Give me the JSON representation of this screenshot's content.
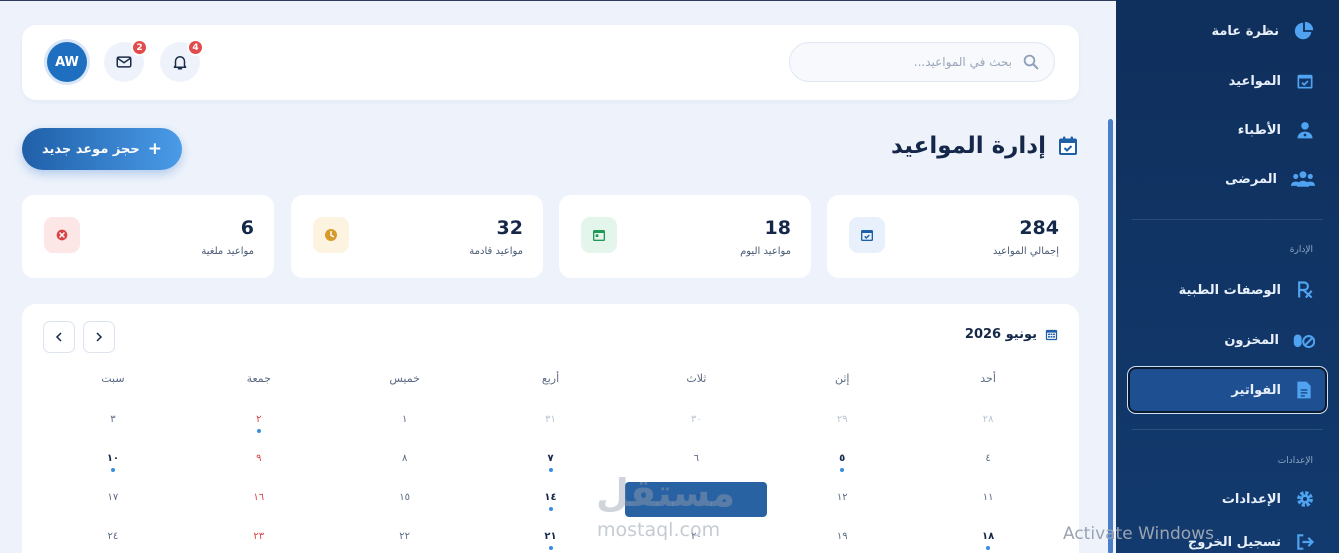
{
  "header": {
    "search_placeholder": "بحث في المواعيد...",
    "notifications_count": "4",
    "messages_count": "2",
    "avatar_initials": "AW"
  },
  "page": {
    "title": "إدارة المواعيد",
    "new_button_label": "حجز موعد جديد"
  },
  "stats": [
    {
      "value": "284",
      "label": "إجمالي المواعيد",
      "icon": "calendar-check-icon",
      "color": "#1f5fa8",
      "bg": "#e8f0fb"
    },
    {
      "value": "18",
      "label": "مواعيد اليوم",
      "icon": "calendar-day-icon",
      "color": "#1f9a55",
      "bg": "#e4f6ec"
    },
    {
      "value": "32",
      "label": "مواعيد قادمة",
      "icon": "clock-icon",
      "color": "#d79a2b",
      "bg": "#fdf3e1"
    },
    {
      "value": "6",
      "label": "مواعيد ملغية",
      "icon": "cancel-icon",
      "color": "#d64545",
      "bg": "#fde6e6"
    }
  ],
  "calendar": {
    "month_title": "يونيو 2026",
    "weekdays": [
      "أحد",
      "إثن",
      "ثلاث",
      "أربع",
      "خميس",
      "جمعة",
      "سبت"
    ],
    "weeks": [
      [
        {
          "d": "٢٨",
          "o": true
        },
        {
          "d": "٢٩",
          "o": true
        },
        {
          "d": "٣٠",
          "o": true
        },
        {
          "d": "٣١",
          "o": true
        },
        {
          "d": "١"
        },
        {
          "d": "٢",
          "f": true,
          "dot": true
        },
        {
          "d": "٣"
        }
      ],
      [
        {
          "d": "٤"
        },
        {
          "d": "٥",
          "b": true,
          "dot": true
        },
        {
          "d": "٦"
        },
        {
          "d": "٧",
          "b": true,
          "dot": true
        },
        {
          "d": "٨"
        },
        {
          "d": "٩",
          "f": true
        },
        {
          "d": "١٠",
          "b": true,
          "dot": true
        }
      ],
      [
        {
          "d": "١١"
        },
        {
          "d": "١٢"
        },
        {
          "d": "١٣"
        },
        {
          "d": "١٤",
          "b": true,
          "dot": true
        },
        {
          "d": "١٥"
        },
        {
          "d": "١٦",
          "f": true
        },
        {
          "d": "١٧"
        }
      ],
      [
        {
          "d": "١٨",
          "b": true,
          "dot": true
        },
        {
          "d": "١٩"
        },
        {
          "d": "٢٠"
        },
        {
          "d": "٢١",
          "b": true,
          "dot": true
        },
        {
          "d": "٢٢"
        },
        {
          "d": "٢٣",
          "f": true
        },
        {
          "d": "٢٤"
        }
      ]
    ]
  },
  "sidebar": {
    "items": [
      {
        "label": "نظرة عامة",
        "icon": "pie-chart-icon"
      },
      {
        "label": "المواعيد",
        "icon": "calendar-check-icon"
      },
      {
        "label": "الأطباء",
        "icon": "doctor-icon"
      },
      {
        "label": "المرضى",
        "icon": "users-icon"
      }
    ],
    "section_admin": "الإدارة",
    "admin_items": [
      {
        "label": "الوصفات الطبية",
        "icon": "prescription-icon"
      },
      {
        "label": "المخزون",
        "icon": "pills-icon"
      },
      {
        "label": "الفواتير",
        "icon": "invoice-icon"
      }
    ],
    "section_settings": "الإعدادات",
    "settings_items": [
      {
        "label": "الإعدادات",
        "icon": "gear-icon"
      },
      {
        "label": "تسجيل الخروج",
        "icon": "logout-icon"
      }
    ]
  },
  "watermark": {
    "arabic": "مستقل",
    "latin": "mostaql.com"
  },
  "os_notice": "Activate Windows"
}
